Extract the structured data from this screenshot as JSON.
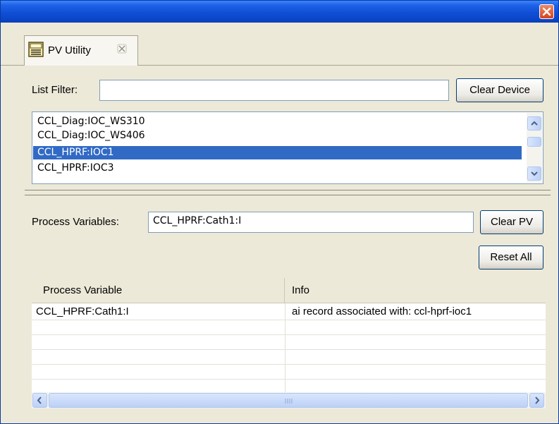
{
  "tab": {
    "label": "PV Utility"
  },
  "filter": {
    "label": "List Filter:",
    "value": "",
    "clear_label": "Clear Device"
  },
  "devices": [
    {
      "name": "CCL_Diag:IOC_WS310",
      "selected": false
    },
    {
      "name": "CCL_Diag:IOC_WS406",
      "selected": false
    },
    {
      "name": "CCL_HPRF:IOC1",
      "selected": true
    },
    {
      "name": "CCL_HPRF:IOC3",
      "selected": false
    }
  ],
  "pv": {
    "label": "Process Variables:",
    "value": "CCL_HPRF:Cath1:I",
    "clear_label": "Clear PV",
    "reset_label": "Reset All"
  },
  "table": {
    "headers": [
      "Process Variable",
      "Info"
    ],
    "rows": [
      {
        "pv": "CCL_HPRF:Cath1:I",
        "info": "ai record associated with: ccl-hprf-ioc1"
      }
    ]
  },
  "colors": {
    "selection": "#316ac5",
    "titlebar": "#0f4fd6",
    "close": "#d5441b"
  },
  "icons": {
    "close": "close-icon",
    "tab": "pv-utility-icon",
    "tab_close": "tab-close-icon"
  }
}
